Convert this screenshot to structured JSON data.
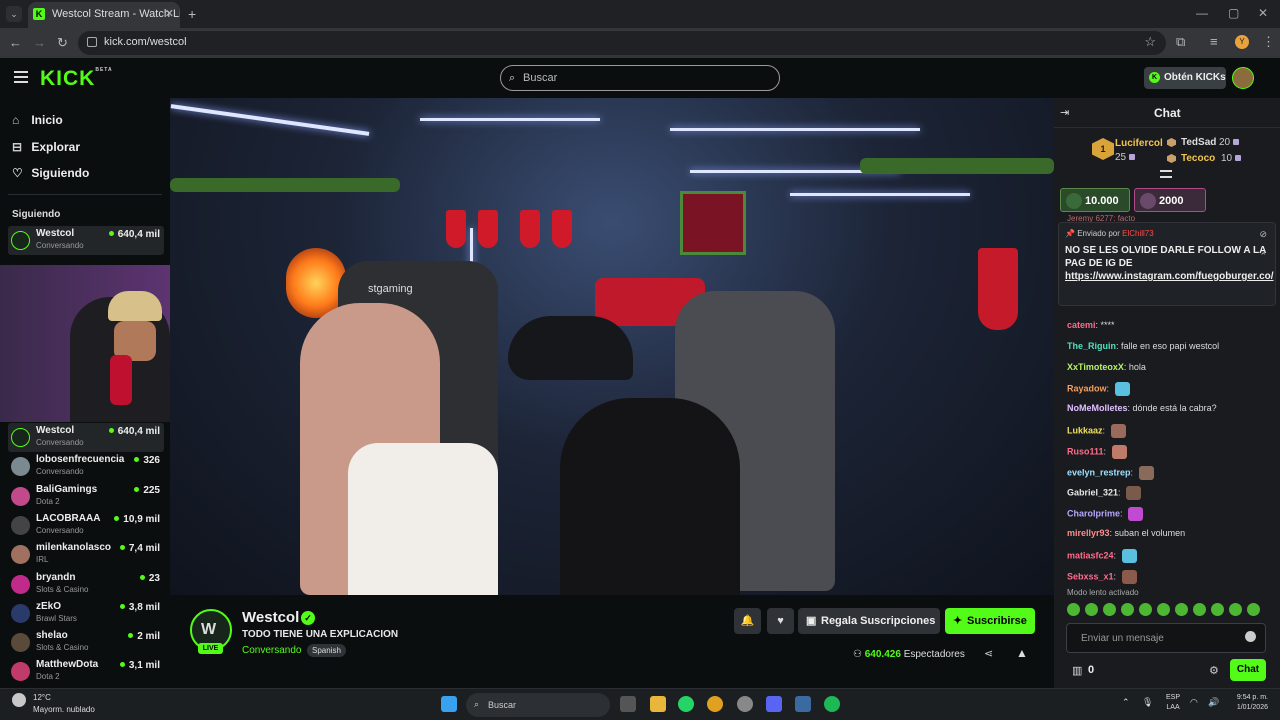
{
  "browser": {
    "tab_title": "Westcol Stream - Watch Li...",
    "tab_favicon": "K",
    "url": "kick.com/westcol",
    "profile_initial": "Y"
  },
  "header": {
    "logo": "KICK",
    "logo_badge": "BETA",
    "search_placeholder": "Buscar",
    "get_kicks": "Obtén KICKs",
    "accent": "#53fc18"
  },
  "sidebar": {
    "nav": [
      {
        "label": "Inicio",
        "icon": "home-icon"
      },
      {
        "label": "Explorar",
        "icon": "compass-icon"
      },
      {
        "label": "Siguiendo",
        "icon": "heart-icon"
      }
    ],
    "following_title": "Siguiendo",
    "following": [
      {
        "name": "Westcol",
        "category": "Conversando",
        "viewers": "640,4 mil"
      }
    ],
    "recommended": [
      {
        "name": "Westcol",
        "category": "Conversando",
        "viewers": "640,4 mil"
      },
      {
        "name": "lobosenfrecuencia",
        "category": "Conversando",
        "viewers": "326"
      },
      {
        "name": "BaliGamings",
        "category": "Dota 2",
        "viewers": "225"
      },
      {
        "name": "LACOBRAAA",
        "category": "Conversando",
        "viewers": "10,9 mil"
      },
      {
        "name": "milenkanolasco",
        "category": "IRL",
        "viewers": "7,4 mil"
      },
      {
        "name": "bryandn",
        "category": "Slots & Casino",
        "viewers": "23"
      },
      {
        "name": "zEkO",
        "category": "Brawl Stars",
        "viewers": "3,8 mil"
      },
      {
        "name": "shelao",
        "category": "Slots & Casino",
        "viewers": "2 mil"
      },
      {
        "name": "MatthewDota",
        "category": "Dota 2",
        "viewers": "3,1 mil"
      }
    ]
  },
  "stream": {
    "video_sign": "stgaming",
    "channel": "Westcol",
    "title": "TODO TIENE UNA EXPLICACION",
    "category": "Conversando",
    "tag": "Spanish",
    "live": "LIVE",
    "gift_label": "Regala Suscripciones",
    "subscribe_label": "Suscribirse",
    "viewers": "640.426",
    "viewers_label": "Espectadores"
  },
  "chat": {
    "title": "Chat",
    "leaderboard": {
      "first": {
        "rank": "1",
        "name": "Lucifercol",
        "count": "25"
      },
      "others": [
        {
          "name": "TedSad",
          "count": "20"
        },
        {
          "name": "Tecoco",
          "count": "10"
        }
      ]
    },
    "gift_boxes": [
      {
        "amount": "10.000"
      },
      {
        "amount": "2000"
      }
    ],
    "partial_line": "Jeremy 6277: facto",
    "pinned": {
      "by_label": "Enviado por",
      "by_user": "ElChill73",
      "message": "NO SE LES OLVIDE DARLE FOLLOW A LA PAG DE IG DE",
      "link": "https://www.instagram.com/fuegoburger.co/"
    },
    "messages": [
      {
        "user": "catemi",
        "text": "****",
        "color": "#ff6b8b"
      },
      {
        "user": "The_Riguin",
        "text": "falle en eso papi westcol",
        "color": "#4ee0c0"
      },
      {
        "user": "XxTimoteoxX",
        "text": "hola",
        "color": "#b8f06a"
      },
      {
        "user": "Rayadow",
        "text": "",
        "color": "#f5a05a"
      },
      {
        "user": "NoMeMolletes",
        "text": "dónde está la cabra?",
        "color": "#e0c0ff"
      },
      {
        "user": "Lukkaaz",
        "text": "",
        "color": "#f0e060"
      },
      {
        "user": "Ruso111",
        "text": "",
        "color": "#ff6b8b"
      },
      {
        "user": "evelyn_restrep",
        "text": "",
        "color": "#9be0ff"
      },
      {
        "user": "Gabriel_321",
        "text": "",
        "color": "#e8e8e8"
      },
      {
        "user": "Charolprime",
        "text": "",
        "color": "#b7a6ff"
      },
      {
        "user": "mirellyr93",
        "text": "suban el volumen",
        "color": "#ff8c8c"
      },
      {
        "user": "matiasfc24",
        "text": "",
        "color": "#ff6b8b"
      },
      {
        "user": "Sebxss_x1",
        "text": "",
        "color": "#ff6b8b"
      }
    ],
    "slow_mode": "Modo lento activado",
    "input_placeholder": "Enviar un mensaje",
    "gift_count": "0",
    "send_label": "Chat"
  },
  "taskbar": {
    "temp": "12°C",
    "weather": "Mayorm. nublado",
    "search": "Buscar",
    "lang1": "ESP",
    "lang2": "LAA",
    "time": "9:54 p. m.",
    "date": "1/01/2026"
  }
}
